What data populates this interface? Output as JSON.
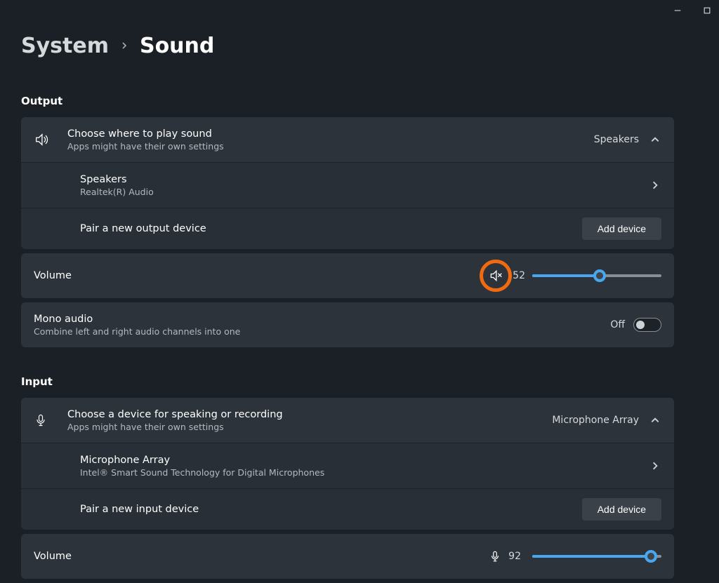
{
  "breadcrumb": {
    "parent": "System",
    "page": "Sound"
  },
  "sections": {
    "output": "Output",
    "input": "Input"
  },
  "output": {
    "choose": {
      "title": "Choose where to play sound",
      "sub": "Apps might have their own settings",
      "current": "Speakers"
    },
    "device": {
      "name": "Speakers",
      "driver": "Realtek(R) Audio"
    },
    "pair": {
      "label": "Pair a new output device",
      "button": "Add device"
    },
    "volume": {
      "label": "Volume",
      "value": "52",
      "percent": 52
    },
    "mono": {
      "title": "Mono audio",
      "sub": "Combine left and right audio channels into one",
      "state": "Off"
    }
  },
  "input": {
    "choose": {
      "title": "Choose a device for speaking or recording",
      "sub": "Apps might have their own settings",
      "current": "Microphone Array"
    },
    "device": {
      "name": "Microphone Array",
      "driver": "Intel® Smart Sound Technology for Digital Microphones"
    },
    "pair": {
      "label": "Pair a new input device",
      "button": "Add device"
    },
    "volume": {
      "label": "Volume",
      "value": "92",
      "percent": 92
    }
  }
}
